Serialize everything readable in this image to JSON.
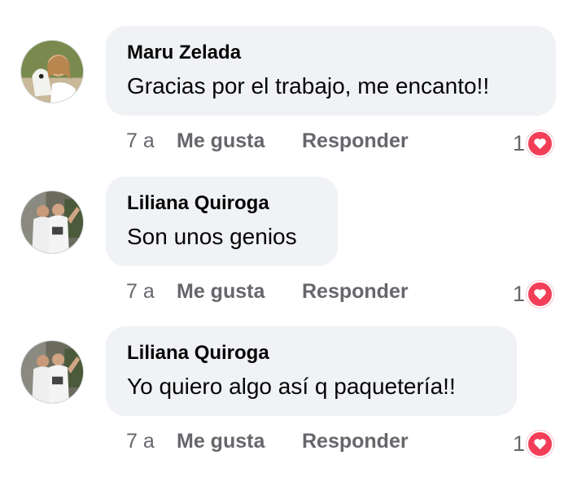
{
  "comments": [
    {
      "author": "Maru Zelada",
      "text": "Gracias por el trabajo, me encanto!!",
      "time": "7 a",
      "like_label": "Me gusta",
      "reply_label": "Responder",
      "reaction_count": "1",
      "reaction_icon": "heart-icon",
      "avatar": "profile-photo"
    },
    {
      "author": "Liliana Quiroga",
      "text": "Son unos genios",
      "time": "7 a",
      "like_label": "Me gusta",
      "reply_label": "Responder",
      "reaction_count": "1",
      "reaction_icon": "heart-icon",
      "avatar": "profile-photo"
    },
    {
      "author": "Liliana Quiroga",
      "text": "Yo quiero algo así q paquetería!!",
      "time": "7 a",
      "like_label": "Me gusta",
      "reply_label": "Responder",
      "reaction_count": "1",
      "reaction_icon": "heart-icon",
      "avatar": "profile-photo"
    }
  ],
  "colors": {
    "bubble_bg": "#f0f2f5",
    "meta_text": "#65676b",
    "love_reaction": "#f33e58"
  }
}
